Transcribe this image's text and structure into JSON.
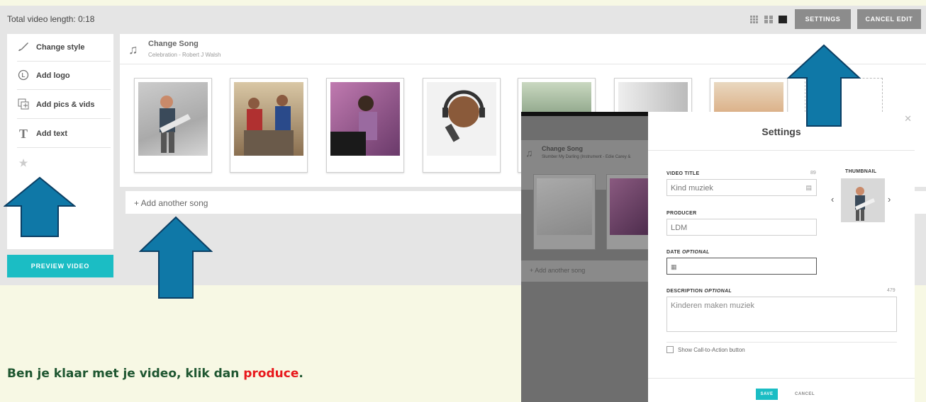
{
  "topbar": {
    "total_length": "Total video length: 0:18",
    "settings_label": "SETTINGS",
    "cancel_edit_label": "CANCEL EDIT",
    "view_icons": [
      "grid-small-icon",
      "grid-large-icon",
      "single-view-icon"
    ]
  },
  "tools": [
    {
      "label": "Change style",
      "icon": "brush-icon"
    },
    {
      "label": "Add logo",
      "icon": "logo-icon"
    },
    {
      "label": "Add pics & vids",
      "icon": "pics-icon"
    },
    {
      "label": "Add text",
      "icon": "text-icon"
    }
  ],
  "preview_label": "PREVIEW VIDEO",
  "song": {
    "title": "Change Song",
    "subtitle": "Celebration - Robert J Walsh",
    "add_another": "+ Add another song"
  },
  "overlay_song": {
    "title": "Change Song",
    "subtitle": "Slumber My Darling (Instrument - Edie Carey &",
    "add_another": "+ Add another song"
  },
  "modal": {
    "title": "Settings",
    "video_title_label": "VIDEO TITLE",
    "video_title_count": "89",
    "video_title_value": "Kind muziek",
    "thumbnail_label": "THUMBNAIL",
    "producer_label": "PRODUCER",
    "producer_value": "LDM",
    "date_label": "DATE",
    "date_optional": "OPTIONAL",
    "description_label": "DESCRIPTION",
    "description_optional": "OPTIONAL",
    "description_count": "479",
    "description_value": "Kinderen maken muziek",
    "cta_label": "Show Call-to-Action button",
    "save_label": "SAVE",
    "cancel_label": "CANCEL"
  },
  "instruction": {
    "text": "Ben je klaar met je video, klik dan ",
    "highlight": "produce",
    "end": "."
  },
  "colors": {
    "accent": "#1bbdc4",
    "arrow_fill": "#0f78a7",
    "arrow_stroke": "#0b3f64",
    "instruction_green": "#1e5630",
    "instruction_red": "#e8171b"
  }
}
